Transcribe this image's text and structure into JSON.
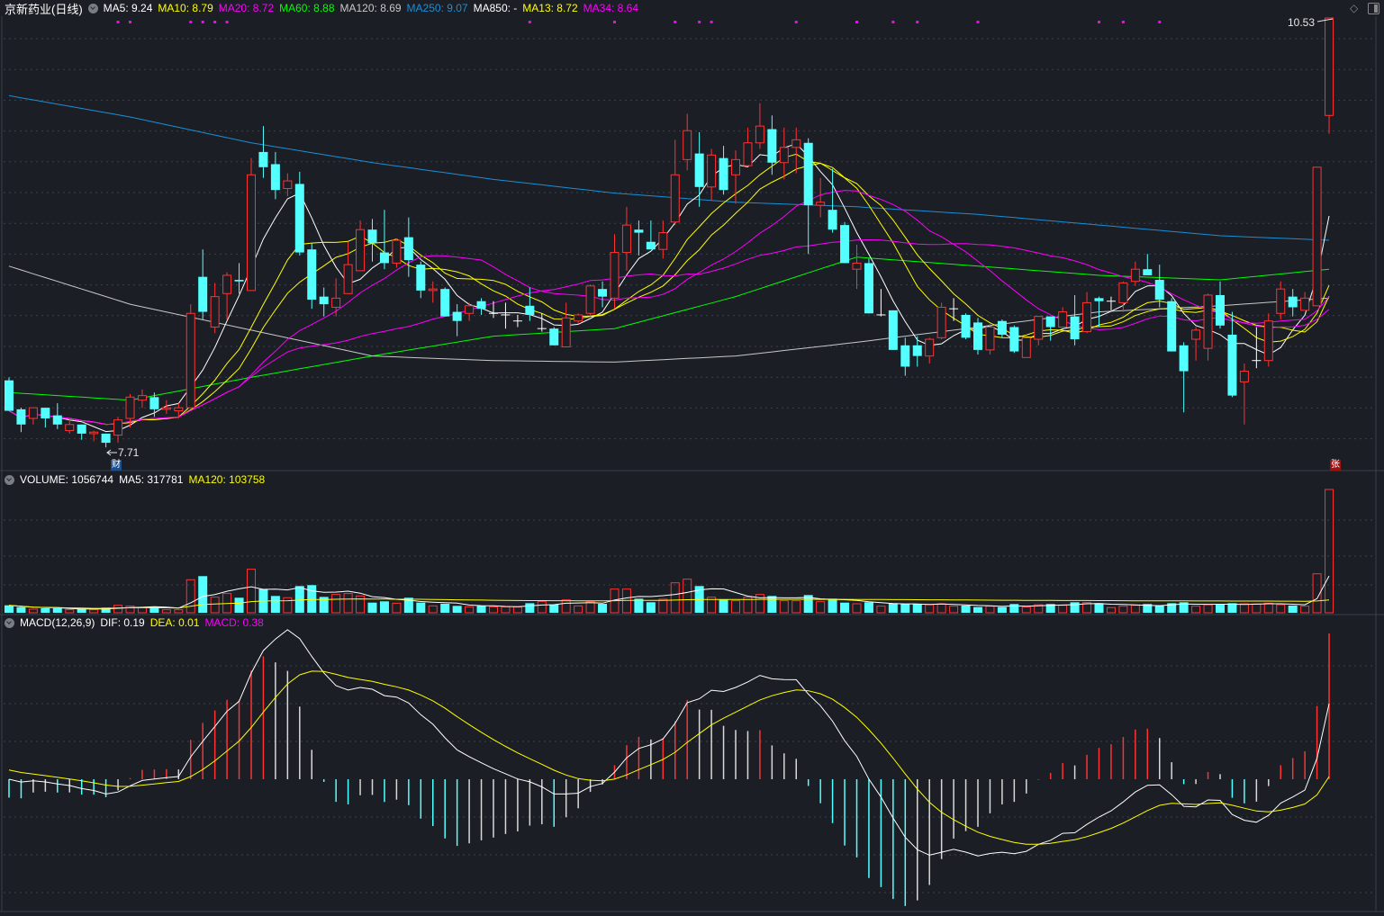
{
  "header": {
    "title": "京新药业(日线)",
    "ma_items": [
      {
        "text": "MA5: 9.24",
        "color": "#ffffff"
      },
      {
        "text": "MA10: 8.79",
        "color": "#ffff00"
      },
      {
        "text": "MA20: 8.72",
        "color": "#ff00ff"
      },
      {
        "text": "MA60: 8.88",
        "color": "#00ff00"
      },
      {
        "text": "MA120: 8.69",
        "color": "#c8c8c8"
      },
      {
        "text": "MA250: 9.07",
        "color": "#1a8fd6"
      },
      {
        "text": "MA850: -",
        "color": "#ffffff"
      },
      {
        "text": "MA13: 8.72",
        "color": "#ffff00"
      },
      {
        "text": "MA34: 8.64",
        "color": "#ff00ff"
      }
    ]
  },
  "volume_header": {
    "items": [
      {
        "text": "VOLUME: 1056744",
        "color": "#ffffff"
      },
      {
        "text": "MA5: 317781",
        "color": "#ffffff"
      },
      {
        "text": "MA120: 103758",
        "color": "#ffff00"
      }
    ]
  },
  "macd_header": {
    "items": [
      {
        "text": "MACD(12,26,9)",
        "color": "#ffffff"
      },
      {
        "text": "DIF: 0.19",
        "color": "#ffffff"
      },
      {
        "text": "DEA: 0.01",
        "color": "#ffff00"
      },
      {
        "text": "MACD: 0.38",
        "color": "#ff00ff"
      }
    ]
  },
  "price_labels": {
    "high": "10.53",
    "low": "7.71"
  },
  "markers": {
    "finance": "财",
    "limit_up": "张"
  },
  "colors": {
    "up": "#ff3232",
    "down": "#54ffff",
    "flat": "#ffffff",
    "background": "#1b1e25",
    "event": "#ff00ff"
  },
  "event_marker_candles": [
    9,
    10,
    15,
    16,
    17,
    18,
    43,
    50,
    55,
    57,
    58,
    65,
    70,
    73,
    75,
    80,
    90,
    92,
    95
  ],
  "chart_data": {
    "type": "candlestick",
    "title": "京新药业(日线)",
    "candle_format": [
      "open",
      "high",
      "low",
      "close"
    ],
    "candles": [
      [
        8.15,
        8.17,
        7.95,
        7.95
      ],
      [
        7.96,
        7.97,
        7.81,
        7.86
      ],
      [
        7.9,
        7.97,
        7.86,
        7.97
      ],
      [
        7.97,
        7.97,
        7.84,
        7.9
      ],
      [
        7.92,
        8.0,
        7.83,
        7.86
      ],
      [
        7.82,
        7.9,
        7.8,
        7.86
      ],
      [
        7.86,
        7.86,
        7.76,
        7.8
      ],
      [
        7.8,
        7.82,
        7.75,
        7.81
      ],
      [
        7.8,
        7.8,
        7.71,
        7.74
      ],
      [
        7.79,
        7.91,
        7.74,
        7.89
      ],
      [
        7.9,
        8.06,
        7.84,
        8.04
      ],
      [
        8.02,
        8.09,
        7.97,
        8.05
      ],
      [
        8.04,
        8.07,
        7.91,
        7.96
      ],
      [
        7.96,
        8.02,
        7.93,
        7.97
      ],
      [
        7.95,
        8.0,
        7.9,
        7.97
      ],
      [
        7.97,
        8.65,
        7.97,
        8.59
      ],
      [
        8.83,
        9.01,
        8.55,
        8.6
      ],
      [
        8.5,
        8.79,
        8.46,
        8.7
      ],
      [
        8.72,
        8.86,
        8.55,
        8.84
      ],
      [
        8.81,
        8.92,
        8.72,
        8.8
      ],
      [
        8.74,
        9.61,
        8.74,
        9.5
      ],
      [
        9.65,
        9.82,
        9.48,
        9.55
      ],
      [
        9.57,
        9.65,
        9.34,
        9.4
      ],
      [
        9.41,
        9.51,
        9.36,
        9.46
      ],
      [
        9.44,
        9.52,
        8.97,
        8.99
      ],
      [
        9.01,
        9.05,
        8.62,
        8.68
      ],
      [
        8.7,
        8.76,
        8.57,
        8.65
      ],
      [
        8.63,
        8.82,
        8.57,
        8.69
      ],
      [
        8.72,
        9.06,
        8.72,
        8.91
      ],
      [
        8.87,
        9.2,
        8.87,
        9.14
      ],
      [
        9.14,
        9.21,
        8.93,
        9.05
      ],
      [
        8.99,
        9.27,
        8.88,
        8.92
      ],
      [
        8.92,
        9.08,
        8.89,
        9.07
      ],
      [
        9.09,
        9.22,
        8.83,
        8.94
      ],
      [
        8.91,
        8.93,
        8.69,
        8.74
      ],
      [
        8.74,
        8.8,
        8.66,
        8.75
      ],
      [
        8.75,
        8.76,
        8.57,
        8.57
      ],
      [
        8.6,
        8.65,
        8.44,
        8.54
      ],
      [
        8.59,
        8.66,
        8.54,
        8.64
      ],
      [
        8.67,
        8.69,
        8.58,
        8.62
      ],
      [
        8.59,
        8.67,
        8.56,
        8.59
      ],
      [
        8.58,
        8.66,
        8.49,
        8.58
      ],
      [
        8.54,
        8.58,
        8.5,
        8.54
      ],
      [
        8.64,
        8.76,
        8.54,
        8.58
      ],
      [
        8.49,
        8.59,
        8.47,
        8.49
      ],
      [
        8.49,
        8.5,
        8.38,
        8.38
      ],
      [
        8.37,
        8.66,
        8.37,
        8.56
      ],
      [
        8.54,
        8.59,
        8.52,
        8.58
      ],
      [
        8.59,
        8.78,
        8.57,
        8.77
      ],
      [
        8.75,
        8.8,
        8.63,
        8.7
      ],
      [
        8.69,
        9.11,
        8.62,
        8.99
      ],
      [
        8.99,
        9.29,
        8.87,
        9.17
      ],
      [
        9.14,
        9.2,
        8.97,
        9.12
      ],
      [
        9.06,
        9.2,
        9.01,
        9.01
      ],
      [
        9.01,
        9.2,
        8.95,
        9.12
      ],
      [
        9.19,
        9.73,
        9.17,
        9.5
      ],
      [
        9.6,
        9.9,
        9.53,
        9.79
      ],
      [
        9.64,
        9.78,
        9.29,
        9.42
      ],
      [
        9.42,
        9.67,
        9.33,
        9.63
      ],
      [
        9.61,
        9.69,
        9.37,
        9.4
      ],
      [
        9.5,
        9.66,
        9.31,
        9.6
      ],
      [
        9.56,
        9.81,
        9.56,
        9.71
      ],
      [
        9.71,
        9.97,
        9.67,
        9.82
      ],
      [
        9.8,
        9.89,
        9.5,
        9.58
      ],
      [
        9.58,
        9.81,
        9.47,
        9.68
      ],
      [
        9.68,
        9.81,
        9.51,
        9.73
      ],
      [
        9.71,
        9.74,
        8.98,
        9.3
      ],
      [
        9.3,
        9.48,
        9.22,
        9.32
      ],
      [
        9.27,
        9.54,
        9.12,
        9.14
      ],
      [
        9.17,
        9.19,
        8.92,
        8.92
      ],
      [
        8.88,
        9.04,
        8.75,
        8.92
      ],
      [
        8.92,
        8.95,
        8.59,
        8.59
      ],
      [
        8.58,
        8.75,
        8.57,
        8.58
      ],
      [
        8.61,
        8.61,
        8.35,
        8.35
      ],
      [
        8.38,
        8.43,
        8.18,
        8.24
      ],
      [
        8.38,
        8.44,
        8.24,
        8.31
      ],
      [
        8.31,
        8.43,
        8.26,
        8.42
      ],
      [
        8.43,
        8.66,
        8.42,
        8.63
      ],
      [
        8.62,
        8.69,
        8.54,
        8.62
      ],
      [
        8.58,
        8.59,
        8.42,
        8.43
      ],
      [
        8.53,
        8.56,
        8.32,
        8.35
      ],
      [
        8.35,
        8.52,
        8.32,
        8.5
      ],
      [
        8.54,
        8.55,
        8.43,
        8.45
      ],
      [
        8.5,
        8.51,
        8.33,
        8.34
      ],
      [
        8.3,
        8.43,
        8.3,
        8.43
      ],
      [
        8.42,
        8.57,
        8.38,
        8.57
      ],
      [
        8.57,
        8.57,
        8.41,
        8.5
      ],
      [
        8.5,
        8.63,
        8.5,
        8.6
      ],
      [
        8.57,
        8.71,
        8.38,
        8.42
      ],
      [
        8.47,
        8.73,
        8.46,
        8.66
      ],
      [
        8.69,
        8.7,
        8.5,
        8.67
      ],
      [
        8.67,
        8.7,
        8.61,
        8.67
      ],
      [
        8.66,
        8.8,
        8.6,
        8.79
      ],
      [
        8.8,
        8.93,
        8.77,
        8.88
      ],
      [
        8.88,
        8.98,
        8.84,
        8.84
      ],
      [
        8.81,
        8.91,
        8.63,
        8.68
      ],
      [
        8.67,
        8.69,
        8.34,
        8.34
      ],
      [
        8.38,
        8.4,
        7.94,
        8.21
      ],
      [
        8.42,
        8.5,
        8.28,
        8.48
      ],
      [
        8.36,
        8.72,
        8.28,
        8.71
      ],
      [
        8.71,
        8.8,
        8.49,
        8.51
      ],
      [
        8.45,
        8.6,
        8.04,
        8.05
      ],
      [
        8.14,
        8.26,
        7.86,
        8.21
      ],
      [
        8.28,
        8.5,
        8.23,
        8.28
      ],
      [
        8.28,
        8.59,
        8.24,
        8.54
      ],
      [
        8.59,
        8.8,
        8.55,
        8.75
      ],
      [
        8.7,
        8.75,
        8.57,
        8.63
      ],
      [
        8.61,
        8.73,
        8.61,
        8.69
      ],
      [
        8.64,
        9.55,
        8.64,
        9.55
      ],
      [
        9.89,
        10.53,
        9.77,
        10.53
      ]
    ],
    "volumes": [
      64000,
      49000,
      31000,
      39000,
      39000,
      26000,
      31000,
      26000,
      44000,
      64000,
      57000,
      44000,
      49000,
      26000,
      26000,
      283000,
      314000,
      134000,
      165000,
      129000,
      373000,
      203000,
      144000,
      129000,
      229000,
      237000,
      136000,
      157000,
      165000,
      144000,
      87000,
      98000,
      82000,
      129000,
      87000,
      59000,
      77000,
      59000,
      51000,
      59000,
      51000,
      51000,
      49000,
      82000,
      98000,
      69000,
      111000,
      59000,
      95000,
      77000,
      203000,
      203000,
      121000,
      90000,
      116000,
      257000,
      288000,
      229000,
      134000,
      113000,
      103000,
      134000,
      157000,
      144000,
      103000,
      103000,
      152000,
      95000,
      121000,
      87000,
      77000,
      90000,
      57000,
      82000,
      75000,
      75000,
      69000,
      77000,
      57000,
      62000,
      49000,
      57000,
      49000,
      75000,
      49000,
      69000,
      75000,
      64000,
      90000,
      87000,
      82000,
      44000,
      57000,
      64000,
      75000,
      64000,
      82000,
      90000,
      57000,
      69000,
      69000,
      82000,
      77000,
      75000,
      82000,
      69000,
      62000,
      57000,
      334000,
      1056744
    ],
    "ma_computed": [
      {
        "name": "MA5",
        "period": 5,
        "color": "#ffffff"
      },
      {
        "name": "MA10",
        "period": 10,
        "color": "#ffff00"
      },
      {
        "name": "MA13",
        "period": 13,
        "color": "#ffff00"
      },
      {
        "name": "MA20",
        "period": 20,
        "color": "#ff00ff"
      },
      {
        "name": "MA34",
        "period": 34,
        "color": "#ff00ff"
      }
    ],
    "ma_sampled": {
      "sample_candles": [
        0,
        10,
        20,
        30,
        40,
        50,
        60,
        70,
        80,
        90,
        100,
        109
      ],
      "series": [
        {
          "name": "MA60",
          "color": "#00ff00",
          "values": [
            8.07,
            8.02,
            8.17,
            8.31,
            8.44,
            8.49,
            8.7,
            8.96,
            8.9,
            8.84,
            8.81,
            8.88
          ]
        },
        {
          "name": "MA120",
          "color": "#c8c8c8",
          "values": [
            8.9,
            8.65,
            8.48,
            8.31,
            8.28,
            8.27,
            8.31,
            8.4,
            8.5,
            8.6,
            8.64,
            8.69
          ]
        },
        {
          "name": "MA250",
          "color": "#1a8fd6",
          "values": [
            10.02,
            9.88,
            9.71,
            9.58,
            9.47,
            9.38,
            9.32,
            9.29,
            9.24,
            9.17,
            9.1,
            9.07
          ]
        }
      ]
    },
    "volume_ma": [
      {
        "name": "MA5",
        "period": 5,
        "color": "#ffffff"
      },
      {
        "name": "MA120",
        "period": 120,
        "color": "#ffff00"
      }
    ],
    "macd": {
      "fast": 12,
      "slow": 26,
      "signal": 9,
      "dif_color": "#ffffff",
      "dea_color": "#ffff00",
      "last": {
        "dif": 0.19,
        "dea": 0.01,
        "macd": 0.38
      }
    },
    "price_range": [
      7.71,
      10.53
    ]
  }
}
